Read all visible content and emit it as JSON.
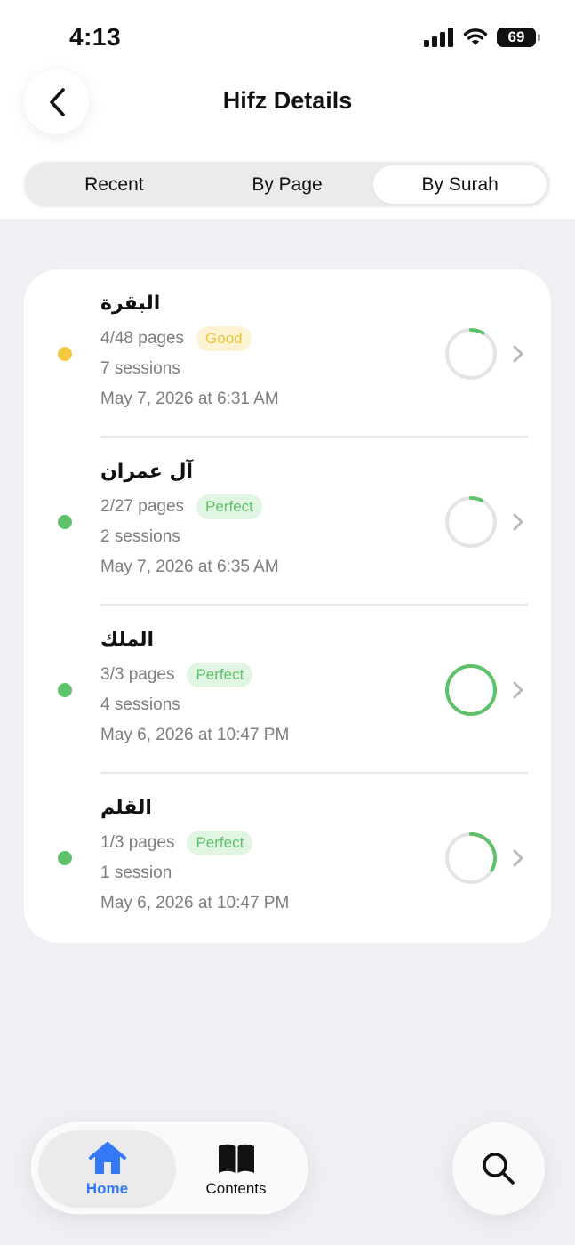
{
  "status_bar": {
    "time": "4:13",
    "battery": "69"
  },
  "header": {
    "title": "Hifz Details"
  },
  "segments": [
    {
      "label": "Recent",
      "active": false
    },
    {
      "label": "By Page",
      "active": false
    },
    {
      "label": "By Surah",
      "active": true
    }
  ],
  "surahs": [
    {
      "name": "البقرة",
      "pages": "4/48 pages",
      "badge": "Good",
      "badge_type": "good",
      "dot_color": "#f5c842",
      "sessions": "7 sessions",
      "date": "May 7, 2026 at 6:31 AM",
      "progress": 0.0833
    },
    {
      "name": "آل عمران",
      "pages": "2/27 pages",
      "badge": "Perfect",
      "badge_type": "perfect",
      "dot_color": "#5ec26a",
      "sessions": "2 sessions",
      "date": "May 7, 2026 at 6:35 AM",
      "progress": 0.074
    },
    {
      "name": "الملك",
      "pages": "3/3 pages",
      "badge": "Perfect",
      "badge_type": "perfect",
      "dot_color": "#5ec26a",
      "sessions": "4 sessions",
      "date": "May 6, 2026 at 10:47 PM",
      "progress": 1.0
    },
    {
      "name": "القلم",
      "pages": "1/3 pages",
      "badge": "Perfect",
      "badge_type": "perfect",
      "dot_color": "#5ec26a",
      "sessions": "1 session",
      "date": "May 6, 2026 at 10:47 PM",
      "progress": 0.333
    }
  ],
  "tabbar": {
    "home_label": "Home",
    "contents_label": "Contents"
  },
  "colors": {
    "accent": "#3478f6",
    "ring_track": "#e4e4e6",
    "ring_fill": "#5ec26a"
  }
}
